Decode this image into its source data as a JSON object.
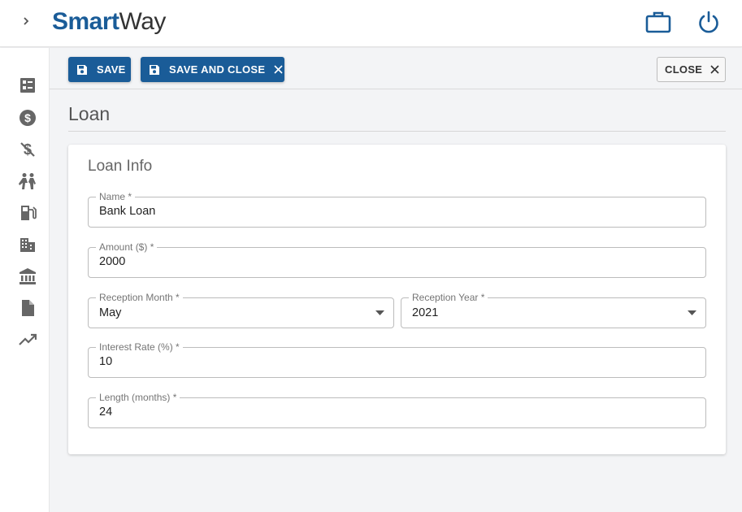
{
  "header": {
    "logo_bold": "Smart",
    "logo_rest": "Way",
    "expand_icon": "chevron-right-icon",
    "briefcase_icon": "briefcase-icon",
    "power_icon": "power-icon"
  },
  "sidebar": {
    "items": [
      {
        "icon": "checklist-icon"
      },
      {
        "icon": "dollar-circle-icon"
      },
      {
        "icon": "money-off-icon"
      },
      {
        "icon": "people-icon"
      },
      {
        "icon": "fuel-pump-icon"
      },
      {
        "icon": "buildings-icon"
      },
      {
        "icon": "bank-icon"
      },
      {
        "icon": "document-icon"
      },
      {
        "icon": "trending-up-icon"
      }
    ]
  },
  "toolbar": {
    "save_label": "SAVE",
    "save_close_label": "SAVE AND CLOSE",
    "close_label": "CLOSE"
  },
  "page": {
    "title": "Loan"
  },
  "form": {
    "section_title": "Loan Info",
    "name": {
      "label": "Name *",
      "value": "Bank Loan"
    },
    "amount": {
      "label": "Amount ($) *",
      "value": "2000"
    },
    "reception_month": {
      "label": "Reception Month *",
      "value": "May"
    },
    "reception_year": {
      "label": "Reception Year *",
      "value": "2021"
    },
    "interest_rate": {
      "label": "Interest Rate (%) *",
      "value": "10"
    },
    "length": {
      "label": "Length (months) *",
      "value": "24"
    }
  },
  "colors": {
    "brand": "#1a5c98",
    "icon_gray": "#666666",
    "background": "#f3f4f6"
  }
}
